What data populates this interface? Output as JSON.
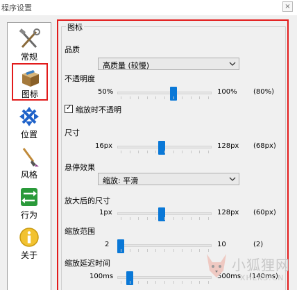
{
  "window": {
    "title": "程序设置",
    "close_label": "×"
  },
  "sidebar": {
    "items": [
      {
        "label": "常规",
        "icon": "tools-icon"
      },
      {
        "label": "图标",
        "icon": "box-icon",
        "selected": true
      },
      {
        "label": "位置",
        "icon": "arrows-icon"
      },
      {
        "label": "风格",
        "icon": "brush-icon"
      },
      {
        "label": "行为",
        "icon": "switch-arrows-icon"
      },
      {
        "label": "关于",
        "icon": "info-icon"
      }
    ]
  },
  "panel": {
    "group_title": "图标",
    "quality": {
      "label": "品质",
      "value": "高质量 (较慢)"
    },
    "opacity": {
      "label": "不透明度",
      "min_label": "50%",
      "max_label": "100%",
      "value_label": "(80%)",
      "min": 50,
      "max": 100,
      "value": 80
    },
    "opaque_on_zoom": {
      "label": "缩放时不透明",
      "checked": true,
      "check_glyph": "✓"
    },
    "size": {
      "label": "尺寸",
      "min_label": "16px",
      "max_label": "128px",
      "value_label": "(68px)",
      "min": 16,
      "max": 128,
      "value": 68
    },
    "hover_effect": {
      "label": "悬停效果",
      "value": "缩放: 平滑"
    },
    "zoomed_size": {
      "label": "放大后的尺寸",
      "min_label": "1px",
      "max_label": "128px",
      "value_label": "(60px)",
      "min": 1,
      "max": 128,
      "value": 60
    },
    "zoom_range": {
      "label": "缩放范围",
      "min_label": "2",
      "max_label": "10",
      "value_label": "(2)",
      "min": 2,
      "max": 10,
      "value": 2
    },
    "zoom_delay": {
      "label": "缩放延迟时间",
      "min_label": "100ms",
      "max_label": "500ms",
      "value_label": "(140ms)",
      "min": 100,
      "max": 500,
      "value": 140
    }
  },
  "watermark": {
    "text": "小狐狸网",
    "url": "XHLKS.CN"
  },
  "colors": {
    "highlight": "#e21b1b",
    "accent": "#0a78d7"
  }
}
